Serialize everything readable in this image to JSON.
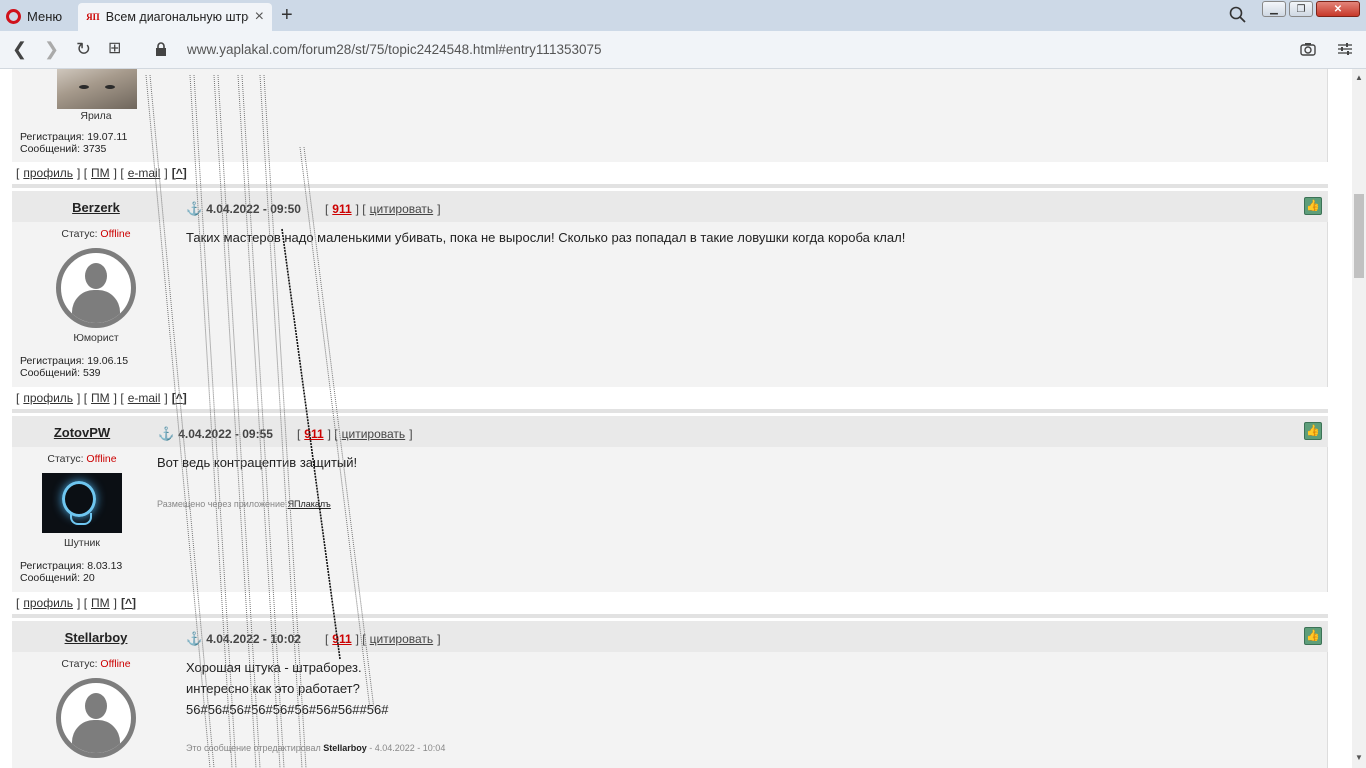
{
  "browser": {
    "menu_label": "Меню",
    "tab_title": "Всем диагональную штро",
    "tab_favicon": "ЯП",
    "url": "www.yaplakal.com/forum28/st/75/topic2424548.html#entry111353075"
  },
  "colors": {
    "offline": "#c00000",
    "post_bg": "#f3f3f3",
    "header_bg": "#e9e9e9",
    "rating": "#cc0000"
  },
  "top_post": {
    "rank": "Ярила",
    "reg": "Регистрация: 19.07.11",
    "msgs": "Сообщений: 3735",
    "footer": {
      "profile": "профиль",
      "pm": "ПМ",
      "email": "e-mail",
      "up": "^"
    }
  },
  "posts": [
    {
      "user": "Berzerk",
      "status_label": "Статус:",
      "status": "Offline",
      "rank": "Юморист",
      "reg": "Регистрация: 19.06.15",
      "msgs": "Сообщений: 539",
      "date": "4.04.2022 - 09:50",
      "rating": "911",
      "quote": "цитировать",
      "text": "Таких мастеров надо маленькими убивать, пока не выросли! Сколько раз попадал в такие ловушки когда короба клал!",
      "footer": {
        "profile": "профиль",
        "pm": "ПМ",
        "email": "e-mail",
        "up": "^"
      }
    },
    {
      "user": "ZotovPW",
      "status_label": "Статус:",
      "status": "Offline",
      "rank": "Шутник",
      "reg": "Регистрация: 8.03.13",
      "msgs": "Сообщений: 20",
      "date": "4.04.2022 - 09:55",
      "rating": "911",
      "quote": "цитировать",
      "text": "Вот ведь контрацептив защитый!",
      "app_note": "Размещено через приложение",
      "app_name": "ЯПлакалъ",
      "footer": {
        "profile": "профиль",
        "pm": "ПМ",
        "up": "^"
      }
    },
    {
      "user": "Stellarboy",
      "status_label": "Статус:",
      "status": "Offline",
      "date": "4.04.2022 - 10:02",
      "rating": "911",
      "quote": "цитировать",
      "lines": [
        "Хорошая штука - штраборез.",
        "интересно как это работает?",
        "56#56#56#56#56#56#56#56##56#"
      ],
      "edit_note": "Это сообщение отредактировал",
      "edit_user": "Stellarboy",
      "edit_date": "- 4.04.2022 - 10:04"
    }
  ]
}
